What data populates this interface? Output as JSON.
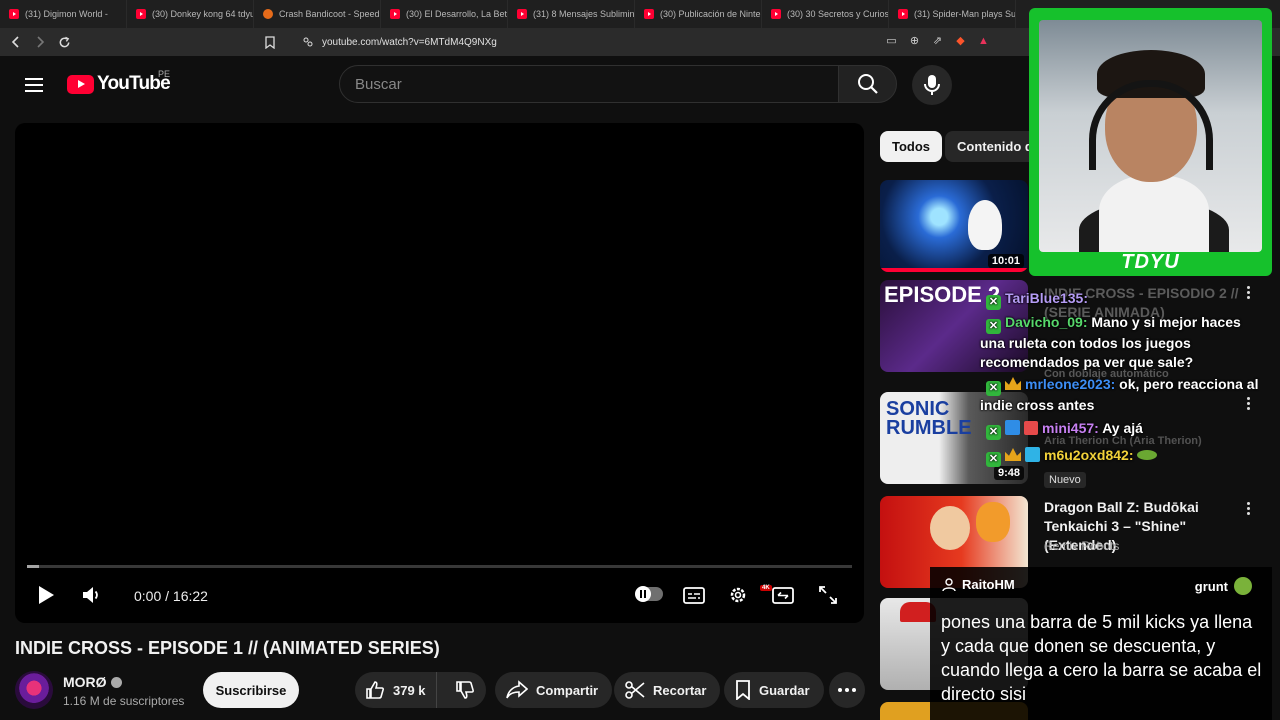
{
  "browser": {
    "tabs": [
      {
        "label": "(31) Digimon World - ",
        "fav": "youtube"
      },
      {
        "label": "(30) Donkey kong 64 tdyu",
        "fav": "youtube"
      },
      {
        "label": "Crash Bandicoot - Speedr",
        "fav": "crash"
      },
      {
        "label": "(30) El Desarrollo, La Beta",
        "fav": "youtube"
      },
      {
        "label": "(31) 8 Mensajes Sublimina",
        "fav": "youtube"
      },
      {
        "label": "(30) Publicación de Ninter",
        "fav": "youtube"
      },
      {
        "label": "(30) 30 Secretos y Curiosic",
        "fav": "youtube"
      },
      {
        "label": "(31) Spider-Man plays Sup",
        "fav": "youtube"
      }
    ],
    "url": "youtube.com/watch?v=6MTdM4Q9NXg"
  },
  "header": {
    "logo_text": "YouTube",
    "country_code": "PE",
    "search_placeholder": "Buscar"
  },
  "player": {
    "time": "0:00 / 16:22",
    "progress_fraction": 0.0,
    "hd_badge": "4K"
  },
  "video": {
    "title": "INDIE CROSS - EPISODE 1 // (ANIMATED SERIES)",
    "channel": "MORØ",
    "subscribers": "1.16 M de suscriptores",
    "subscribe_label": "Suscribirse",
    "likes": "379 k",
    "share_label": "Compartir",
    "clip_label": "Recortar",
    "save_label": "Guardar"
  },
  "sidebar": {
    "chips": [
      "Todos",
      "Contenido d"
    ],
    "items": [
      {
        "title": "INDIE CROSS - EPISODIO 2 // (SERIE ANIMADA)",
        "duration": "10:01"
      },
      {
        "title": "Con doblaje automático",
        "duration": ""
      },
      {
        "title": "Aria Therion Ch (Aria Therion)",
        "duration": "9:48",
        "badge": "Nuevo"
      },
      {
        "title": "Dragon Ball Z: Budōkai Tenkaichi 3 – \"Shine\" (Extended)",
        "channel": "Remix Robots"
      }
    ]
  },
  "overlay": {
    "cam_name": "TDYU",
    "chat": [
      {
        "user": "TariBlue135:",
        "user_color": "#b59cf5",
        "text": ""
      },
      {
        "user": "Davicho_09:",
        "user_color": "#57d86b",
        "text": "Mano y si mejor haces una ruleta con todos los juegos recomendados pa ver que sale?"
      },
      {
        "user": "mrleone2023:",
        "user_color": "#3d8ef5",
        "text": "ok, pero reacciona al indie cross antes"
      },
      {
        "user": "mini457:",
        "user_color": "#c780f2",
        "text": "Ay ajá"
      },
      {
        "user": "m6u2oxd842:",
        "user_color": "#f2d23a",
        "text": ""
      }
    ],
    "card": {
      "user": "RaitoHM",
      "tag": "grunt",
      "message": "pones una barra de 5 mil kicks ya llena y cada que donen se descuenta, y cuando llega a cero la barra se acaba el directo sisi"
    }
  },
  "colors": {
    "youtube_red": "#ff0033",
    "cam_green": "#16c12c",
    "background": "#0f0f0f"
  }
}
